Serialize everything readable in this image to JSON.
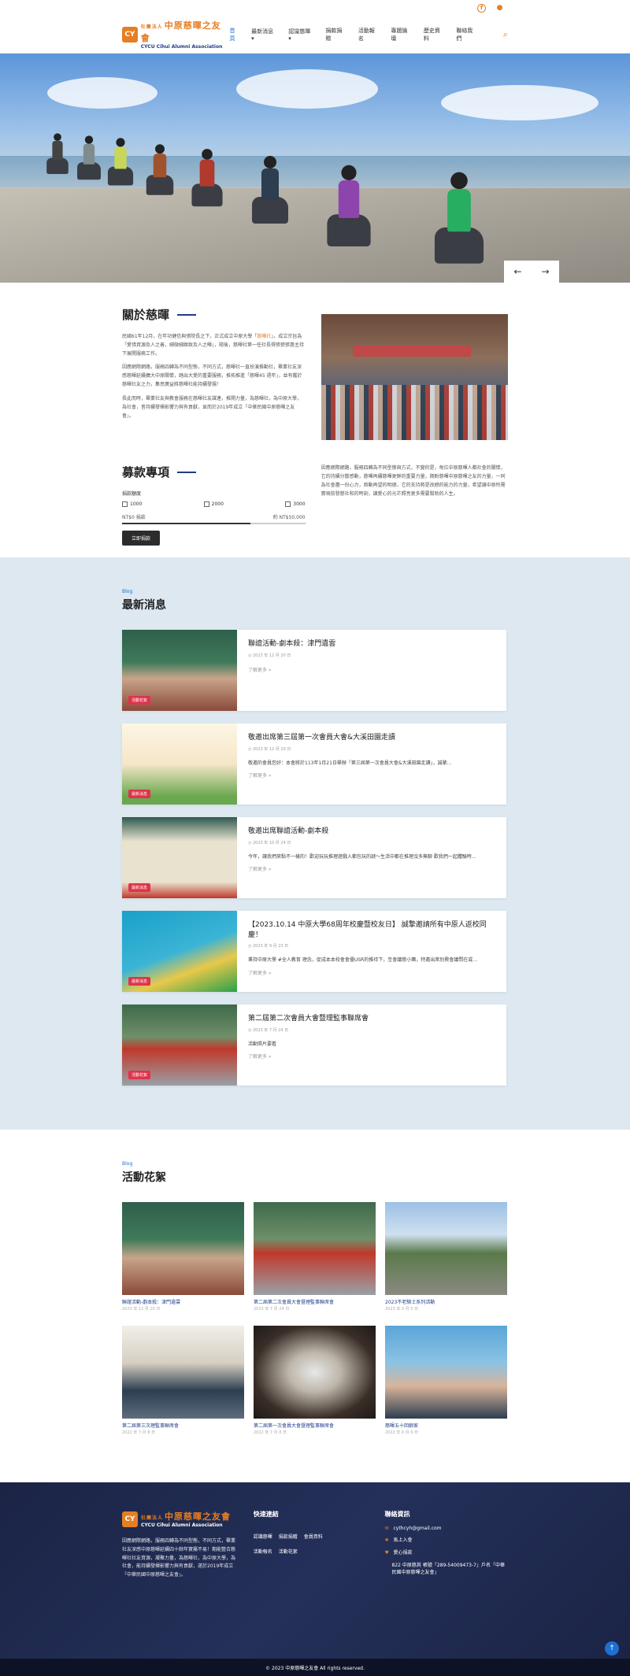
{
  "brand": {
    "logo_mark": "CY",
    "prefix": "社團法人",
    "name": "中原慈暉之友會",
    "name_en": "CYCU Cihui Alumni Association"
  },
  "nav": [
    "首頁",
    "最新消息 ▾",
    "認識慈暉 ▾",
    "捐款捐贈",
    "活動報名",
    "專題論壇",
    "歷史資料",
    "聯絡我們"
  ],
  "about": {
    "title": "關於慈暉",
    "p1a": "民國61年12月，在年功健信與張院長之下，正式成立中原大學「",
    "p1hl": "慈暉社",
    "p1b": "」，成立宗旨為「愛惜資源及人之善，細微細緻致及人之暉」，隨後，慈暉社第一任社長得張張張惠主持下展開服務工作。",
    "p2": "因應網際網路，服務四轉為不同型態，不同方式，慈暉社一直扮演推動社，畢業社友深感慈暉延續擴大中原關懷，踏出大愛的重要服務，推拓推進「慈暉45 週年」，並有鑑於慈暉社友之力，集思廣益將慈暉社能持續發揚！",
    "p3": "長此而時，畢業社友與教會服務在慈暉社友謀連，推開力量，為慈暉社，為中原大學，為社會，皆持續發揮影響力與有貢獻，並而於2019年成立「中華民國中原慈暉之友會」。"
  },
  "donate": {
    "title": "募款專項",
    "amount_label": "捐款額度",
    "options": [
      "1000",
      "2000",
      "3000"
    ],
    "current": "NT$0 捐款",
    "max": "約 NT$50,000",
    "button": "立即捐款",
    "desc": "因應網際網路，服務四轉為不同型態與方式，不變的是，每位中原慈暉人都社會的關懷，它的持續分散感動，慈暉再續慈暉更鮮的重要力量，期盼慈暉中原慈暉之友的力量，一同為社會盡一份心力，齊動再望的明德，它的支持將是改撼的能力的力量，希望讓中原所需實現前發慈社和的時刻，讓愛心的光芒照亮更多需要幫助的人生。"
  },
  "news": {
    "eyebrow": "Blog",
    "title": "最新消息",
    "items": [
      {
        "title": "聯誼活動-劇本殺：津門遺雲",
        "date": "2023 年 12 月 20 日",
        "excerpt": "",
        "more": "了解更多 »",
        "tag": "活動花絮"
      },
      {
        "title": "敬邀出席第三屆第一次會員大會&大溪田園走讀",
        "date": "2023 年 12 月 20 日",
        "excerpt": "敬邀的會員您好：本會將於113年1月21日舉辦「第三屆第一次會員大會&大溪田園走讀」，誠摯…",
        "more": "了解更多 »",
        "tag": "最新消息"
      },
      {
        "title": "敬邀出席聯誼活動-劇本殺",
        "date": "2023 年 10 月 24 日",
        "excerpt": "今年，讓我們來點不一樣的！歡迎玩玩推理遊戲入都包玩的謎～生活中都在推理沒多無聊 歡我們一起體驗時…",
        "more": "了解更多 »",
        "tag": "最新消息"
      },
      {
        "title": "【2023.10.14 中原大學68周年校慶暨校友日】 誠摯邀請所有中原人返校同慶！",
        "date": "2023 年 9 月 23 日",
        "excerpt": "秉持中原大學 #全人教育 理念，促成本本校會會優USR的推待下，至會議慈小團，特邀出席別費會議問在或…",
        "more": "了解更多 »",
        "tag": "最新消息"
      },
      {
        "title": "第二屆第二次會員大會暨理監事聯席會",
        "date": "2023 年 7 月 24 日",
        "excerpt": "活動照片要看",
        "more": "了解更多 »",
        "tag": "活動花絮"
      }
    ]
  },
  "gallery": {
    "eyebrow": "Blog",
    "title": "活動花絮",
    "items": [
      {
        "caption": "聯誼活動-劇本殺：津門遺雲",
        "date": "2023 年 12 月 20 日"
      },
      {
        "caption": "第二屆第二次會員大會暨理監事聯席會",
        "date": "2023 年 7 月 24 日"
      },
      {
        "caption": "2023不老騎士系列活動",
        "date": "2023 年 3 月 5 日"
      },
      {
        "caption": "第二屆第三次理監事聯席會",
        "date": "2022 年 7 月 8 日"
      },
      {
        "caption": "第二屆第一次會員大會暨理監事聯席會",
        "date": "2022 年 7 月 8 日"
      },
      {
        "caption": "慈暉五十回娘家",
        "date": "2022 年 6 月 6 日"
      }
    ]
  },
  "footer": {
    "desc": "因應網際網路，服務四轉為不同型態，不同方式，畢業社友深感中原慈暉延續四十餘年實屬不易！期能整合慈暉社社友資源，凝聚力量，為慈暉社，為中原大學，為社會，能持續發揮影響力與有貢獻，遂於2019年成立「中華民國中原慈暉之友會」。",
    "quick_title": "快速連結",
    "links": [
      "認識慈暉",
      "捐款捐贈",
      "會員資料",
      "活動報名",
      "活動花絮"
    ],
    "contact_title": "聯絡資訊",
    "email": "cythcyh@gmail.com",
    "join": "馬上入會",
    "donate": "愛心捐款",
    "address": "822 中原慈其 帳號「289-54009473-7」戶名「中華民國中原慈暉之友會」",
    "copyright": "© 2023 中原慈暉之友會 All rights reserved."
  },
  "colors": {
    "accent": "#e67e22",
    "brand": "#1f3c88",
    "link": "#1f6fd1",
    "tag": "#e0334a",
    "news_bg": "#dde8f1",
    "footer_bg": "#1b2445"
  }
}
